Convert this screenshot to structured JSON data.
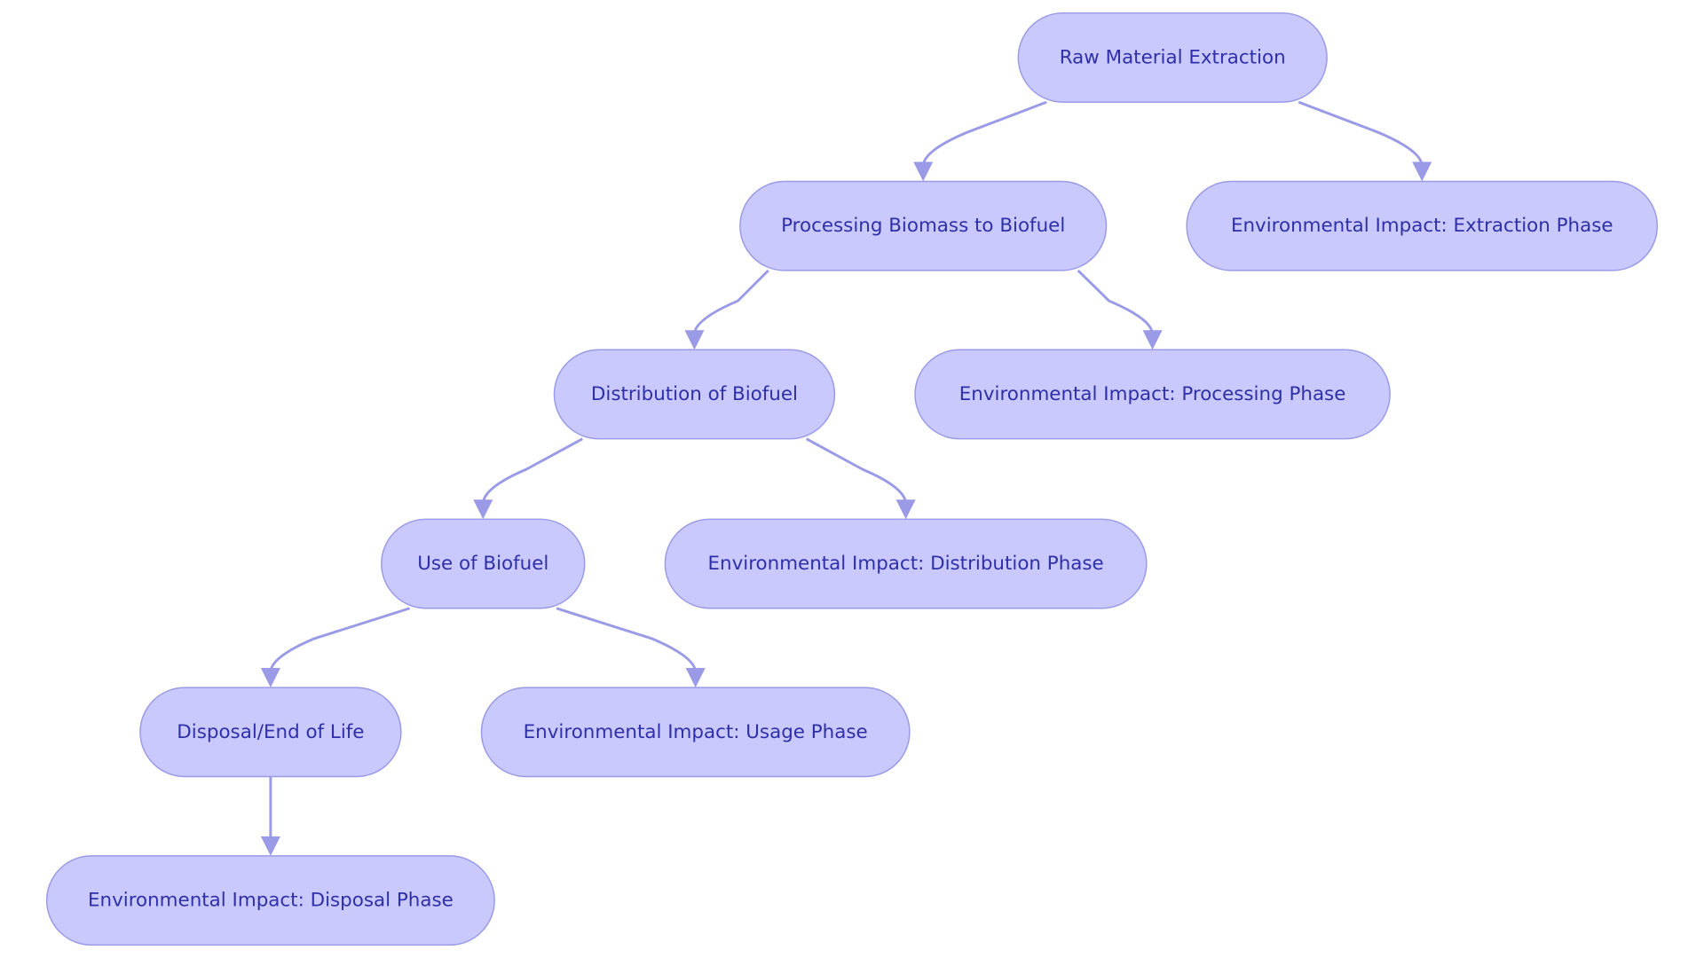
{
  "diagram": {
    "type": "flowchart",
    "direction": "top-down",
    "colors": {
      "node_fill": "#c9c9fd",
      "node_stroke": "#9a9ae6",
      "text": "#2f2fa8",
      "edge": "#9a9ae6"
    },
    "nodes": [
      {
        "id": "raw",
        "label": "Raw Material Extraction"
      },
      {
        "id": "proc",
        "label": "Processing Biomass to Biofuel"
      },
      {
        "id": "env_ext",
        "label": "Environmental Impact: Extraction Phase"
      },
      {
        "id": "dist",
        "label": "Distribution of Biofuel"
      },
      {
        "id": "env_proc",
        "label": "Environmental Impact: Processing Phase"
      },
      {
        "id": "use",
        "label": "Use of Biofuel"
      },
      {
        "id": "env_dist",
        "label": "Environmental Impact: Distribution Phase"
      },
      {
        "id": "disp",
        "label": "Disposal/End of Life"
      },
      {
        "id": "env_use",
        "label": "Environmental Impact: Usage Phase"
      },
      {
        "id": "env_disp",
        "label": "Environmental Impact: Disposal Phase"
      }
    ],
    "edges": [
      {
        "from": "raw",
        "to": "proc"
      },
      {
        "from": "raw",
        "to": "env_ext"
      },
      {
        "from": "proc",
        "to": "dist"
      },
      {
        "from": "proc",
        "to": "env_proc"
      },
      {
        "from": "dist",
        "to": "use"
      },
      {
        "from": "dist",
        "to": "env_dist"
      },
      {
        "from": "use",
        "to": "disp"
      },
      {
        "from": "use",
        "to": "env_use"
      },
      {
        "from": "disp",
        "to": "env_disp"
      }
    ]
  }
}
